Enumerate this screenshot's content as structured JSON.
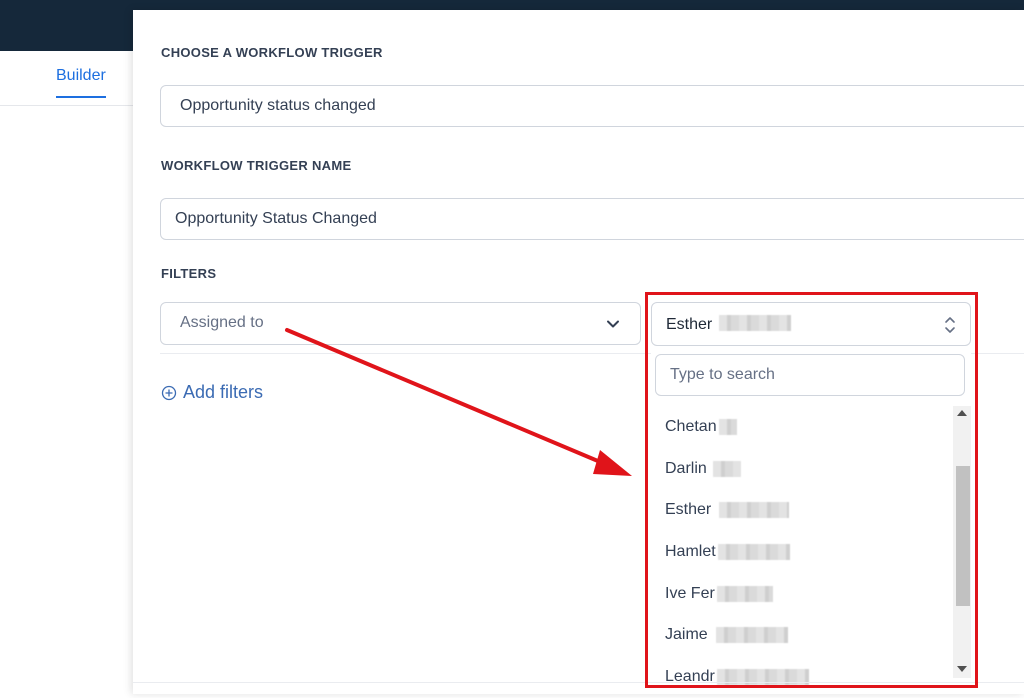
{
  "nav": {
    "builder_tab": "Builder"
  },
  "panel": {
    "trigger_label": "CHOOSE A WORKFLOW TRIGGER",
    "trigger_value": "Opportunity status changed",
    "name_label": "WORKFLOW TRIGGER NAME",
    "name_value": "Opportunity Status Changed",
    "filters_label": "FILTERS",
    "filter_field_placeholder": "Assigned to",
    "add_filters": "Add filters"
  },
  "user_select": {
    "selected": "Esther",
    "search_placeholder": "Type to search",
    "options": [
      "Chetan",
      "Darlin",
      "Esther",
      "Hamlet",
      "Ive Fer",
      "Jaime",
      "Leandr"
    ]
  },
  "annotation": {
    "highlight_color": "#e0141a"
  },
  "icons": {
    "chevron": "chevron-down-icon",
    "updown": "updown-chevron-icon",
    "plus": "plus-circle-icon"
  }
}
